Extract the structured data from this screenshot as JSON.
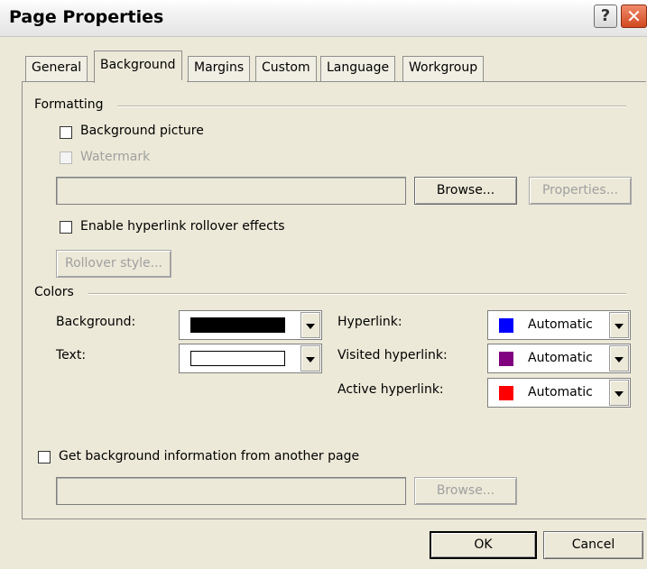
{
  "window": {
    "title": "Page Properties",
    "help_glyph": "?",
    "close_glyph": "✕"
  },
  "tabs": [
    {
      "label": "General"
    },
    {
      "label": "Background"
    },
    {
      "label": "Margins"
    },
    {
      "label": "Custom"
    },
    {
      "label": "Language"
    },
    {
      "label": "Workgroup"
    }
  ],
  "active_tab": "Background",
  "formatting": {
    "group_label": "Formatting",
    "background_picture": {
      "label": "Background picture",
      "checked": false
    },
    "watermark": {
      "label": "Watermark",
      "checked": false,
      "enabled": false
    },
    "picture_path": "",
    "browse_label": "Browse...",
    "properties_label": "Properties...",
    "rollover": {
      "label": "Enable hyperlink rollover effects",
      "checked": false
    },
    "rollover_style_label": "Rollover style..."
  },
  "colors": {
    "group_label": "Colors",
    "background": {
      "label": "Background:",
      "value_color": "#000000"
    },
    "text": {
      "label": "Text:",
      "value_color": "#ffffff"
    },
    "hyperlink": {
      "label": "Hyperlink:",
      "value": "Automatic",
      "swatch": "#0000ff"
    },
    "visited_hyperlink": {
      "label": "Visited hyperlink:",
      "value": "Automatic",
      "swatch": "#800080"
    },
    "active_hyperlink": {
      "label": "Active hyperlink:",
      "value": "Automatic",
      "swatch": "#ff0000"
    }
  },
  "another_page": {
    "label": "Get background information from another page",
    "checked": false,
    "path": "",
    "browse_label": "Browse..."
  },
  "footer": {
    "ok_label": "OK",
    "cancel_label": "Cancel"
  }
}
